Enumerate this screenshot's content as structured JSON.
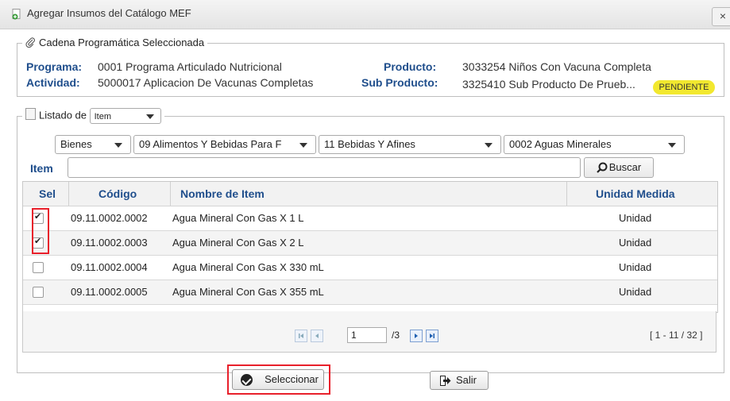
{
  "window": {
    "title": "Agregar Insumos del Catálogo MEF",
    "close_label": "×"
  },
  "cadena": {
    "legend": "Cadena Programática Seleccionada",
    "programa_label": "Programa:",
    "programa_value": "0001 Programa Articulado Nutricional",
    "actividad_label": "Actividad:",
    "actividad_value": "5000017 Aplicacion De Vacunas Completas",
    "producto_label": "Producto:",
    "producto_value": "3033254 Niños Con Vacuna Completa",
    "subproducto_label": "Sub Producto:",
    "subproducto_value": "3325410 Sub Producto De Prueb...",
    "status_badge": "PENDIENTE"
  },
  "listado": {
    "legend_prefix": "Listado de",
    "type_select": "Item",
    "filters": [
      "Bienes",
      "09 Alimentos Y Bebidas Para F",
      "11 Bebidas Y Afines",
      "0002 Aguas Minerales"
    ],
    "item_label": "Item",
    "item_value": "",
    "search_button": "Buscar"
  },
  "table": {
    "columns": [
      "Sel",
      "Código",
      "Nombre de Item",
      "Unidad Medida"
    ],
    "rows": [
      {
        "selected": true,
        "codigo": "09.11.0002.0002",
        "nombre": "Agua Mineral Con Gas X 1 L",
        "unidad": "Unidad"
      },
      {
        "selected": true,
        "codigo": "09.11.0002.0003",
        "nombre": "Agua Mineral Con Gas X 2 L",
        "unidad": "Unidad"
      },
      {
        "selected": false,
        "codigo": "09.11.0002.0004",
        "nombre": "Agua Mineral Con Gas X 330 mL",
        "unidad": "Unidad"
      },
      {
        "selected": false,
        "codigo": "09.11.0002.0005",
        "nombre": "Agua Mineral Con Gas X 355 mL",
        "unidad": "Unidad"
      }
    ]
  },
  "pager": {
    "page": "1",
    "of_pages": "/3",
    "range": "[ 1 - 11 / 32 ]"
  },
  "actions": {
    "select_label": "Seleccionar",
    "exit_label": "Salir"
  },
  "colors": {
    "label_blue": "#1f4e8c",
    "badge_yellow": "#f2e82f",
    "highlight_red": "#e8202b"
  }
}
